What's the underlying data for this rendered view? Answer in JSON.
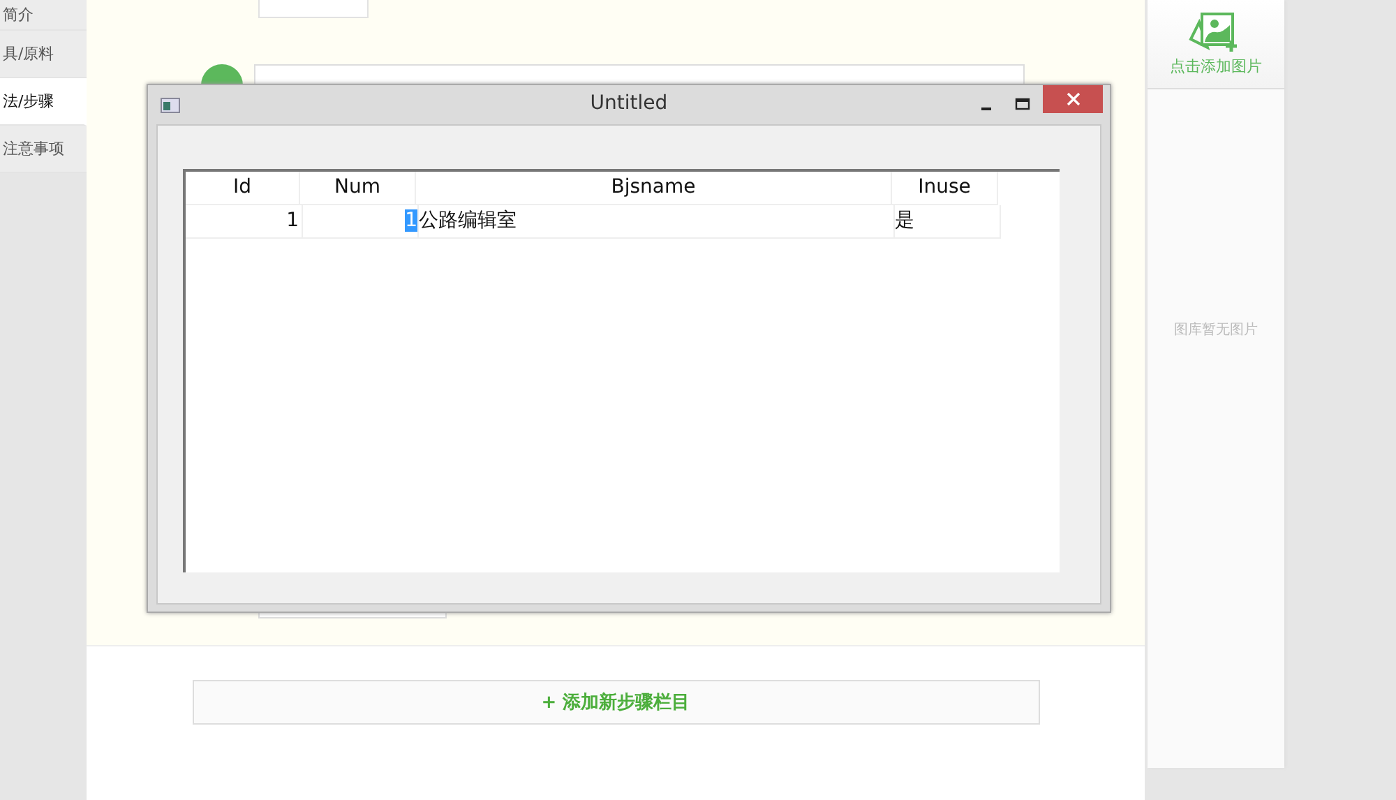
{
  "sidebar": {
    "items": [
      {
        "label": "简介",
        "selected": false
      },
      {
        "label": "具/原料",
        "selected": false
      },
      {
        "label": "法/步骤",
        "selected": true
      },
      {
        "label": "注意事项",
        "selected": false
      }
    ]
  },
  "add_step_button": {
    "label": "+ 添加新步骤栏目"
  },
  "image_panel": {
    "add_button": "点击添加图片",
    "empty_text": "图库暂无图片"
  },
  "dialog": {
    "title": "Untitled",
    "table": {
      "columns": [
        "Id",
        "Num",
        "Bjsname",
        "Inuse"
      ],
      "rows": [
        {
          "cells": [
            {
              "text": "1",
              "selected": false
            },
            {
              "text": "1",
              "selected": true
            },
            {
              "text": "公路编辑室",
              "selected": false
            },
            {
              "text": "是",
              "selected": false
            }
          ]
        }
      ]
    }
  }
}
